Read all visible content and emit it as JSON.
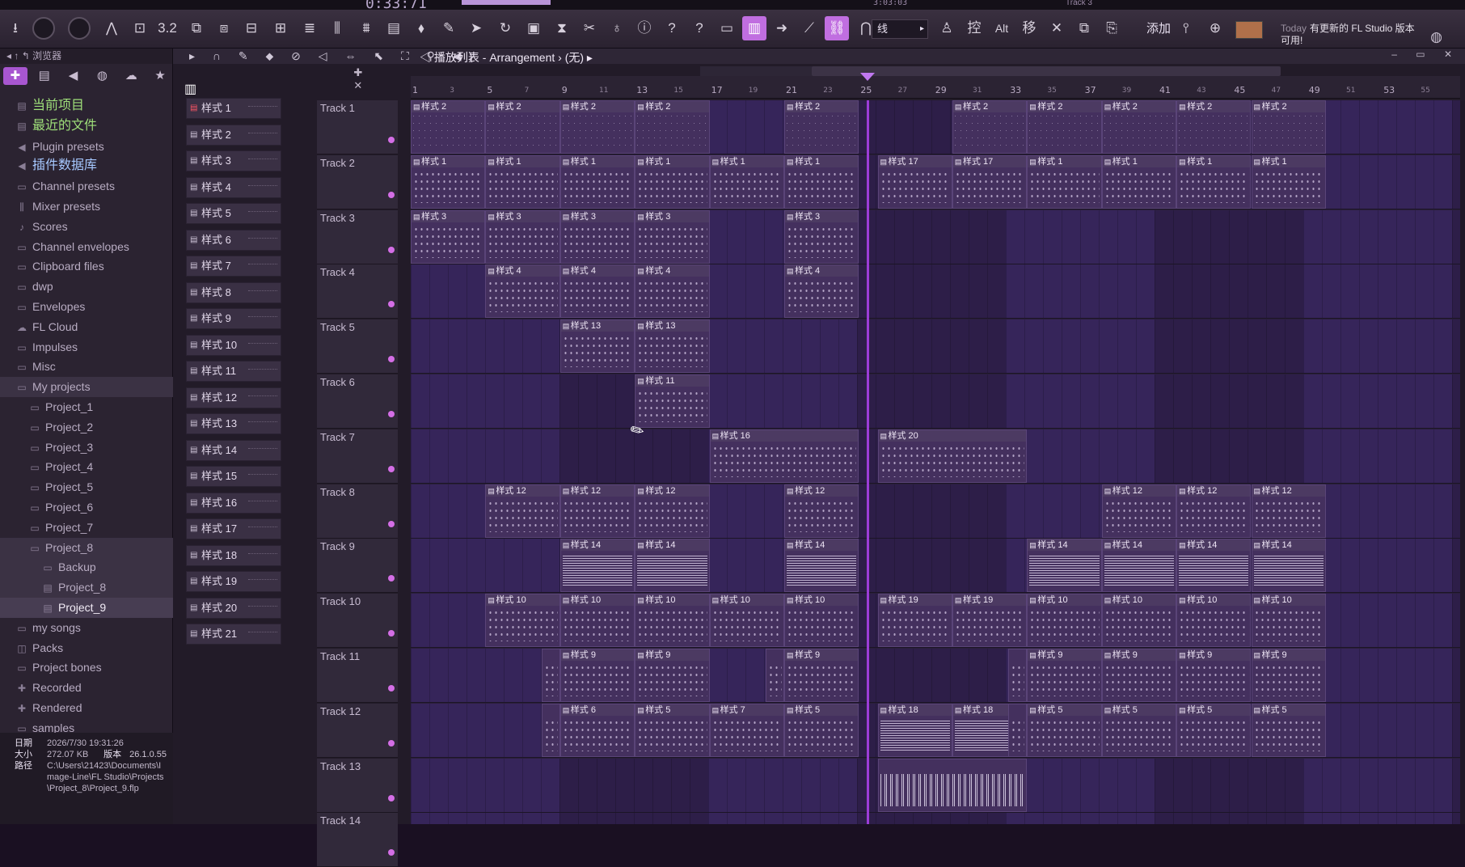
{
  "top_strip": {
    "time": "0:33:71",
    "small_readout": "3:03:03",
    "track_readout": "Track 3"
  },
  "toolbar": {
    "snap_value": "线",
    "add_label": "添加",
    "news_today": "Today",
    "news_text": "有更新的 FL Studio 版本可用!",
    "buttons": [
      {
        "name": "save-icon",
        "glyph": "⭳"
      },
      {
        "name": "master-knob",
        "glyph": ""
      },
      {
        "name": "pitch-knob",
        "glyph": ""
      },
      {
        "name": "tempo-tap-icon",
        "glyph": "⋀"
      },
      {
        "name": "metronome-icon",
        "glyph": "⊡"
      },
      {
        "name": "count-icon",
        "glyph": "3.2"
      },
      {
        "name": "step-icon",
        "glyph": "⧉"
      },
      {
        "name": "wait-icon",
        "glyph": "⧈"
      },
      {
        "name": "loop-rec-icon",
        "glyph": "⊟"
      },
      {
        "name": "overdub-icon",
        "glyph": "⊞"
      },
      {
        "name": "blend-icon",
        "glyph": "≣"
      },
      {
        "name": "mixer-icon",
        "glyph": "⫼"
      },
      {
        "name": "channel-rack-icon",
        "glyph": "⩩"
      },
      {
        "name": "file-icon",
        "glyph": "▤"
      },
      {
        "name": "plugin-icon",
        "glyph": "⬧"
      },
      {
        "name": "brush-icon",
        "glyph": "✎"
      },
      {
        "name": "dragon-icon",
        "glyph": "➤"
      },
      {
        "name": "undo-icon",
        "glyph": "↻"
      },
      {
        "name": "floppy-icon",
        "glyph": "▣"
      },
      {
        "name": "render-icon",
        "glyph": "⧗"
      },
      {
        "name": "scissors-icon",
        "glyph": "✂"
      },
      {
        "name": "mic-icon",
        "glyph": "♁"
      },
      {
        "name": "info-icon",
        "glyph": "ⓘ"
      },
      {
        "name": "help-bubble-icon",
        "glyph": "?"
      },
      {
        "name": "help-icon",
        "glyph": "?"
      },
      {
        "name": "window-icon",
        "glyph": "▭"
      },
      {
        "name": "piano-roll-icon",
        "glyph": "▥"
      },
      {
        "name": "arrow-right-icon",
        "glyph": "➜"
      },
      {
        "name": "draw-icon",
        "glyph": "⟋"
      },
      {
        "name": "link-icon",
        "glyph": "⛓"
      },
      {
        "name": "magnet-icon",
        "glyph": "⋂"
      }
    ],
    "right_buttons": [
      {
        "name": "stamp-icon",
        "glyph": "♙"
      },
      {
        "name": "control-icon",
        "glyph": "控"
      },
      {
        "name": "alt-icon",
        "glyph": "Alt"
      },
      {
        "name": "move-icon",
        "glyph": "移"
      },
      {
        "name": "cut-icon",
        "glyph": "✕"
      },
      {
        "name": "copy-icon",
        "glyph": "⧉"
      },
      {
        "name": "paste-icon",
        "glyph": "⎘"
      }
    ]
  },
  "browser": {
    "title": "浏览器",
    "tabs": [
      {
        "name": "all",
        "glyph": "✚"
      },
      {
        "name": "files",
        "glyph": "▤"
      },
      {
        "name": "speaker",
        "glyph": "◀"
      },
      {
        "name": "plugins",
        "glyph": "◍"
      },
      {
        "name": "cloud",
        "glyph": "☁"
      },
      {
        "name": "star",
        "glyph": "★"
      }
    ],
    "items": [
      {
        "label": "当前项目",
        "style": "hl",
        "icon": "▤"
      },
      {
        "label": "最近的文件",
        "style": "hl",
        "icon": "▤"
      },
      {
        "label": "Plugin presets",
        "style": "",
        "icon": "◀"
      },
      {
        "label": "插件数据库",
        "style": "cyan",
        "icon": "◀"
      },
      {
        "label": "Channel presets",
        "style": "",
        "icon": "▭"
      },
      {
        "label": "Mixer presets",
        "style": "",
        "icon": "⫼"
      },
      {
        "label": "Scores",
        "style": "",
        "icon": "♪"
      },
      {
        "label": "Channel envelopes",
        "style": "",
        "icon": "▭"
      },
      {
        "label": "Clipboard files",
        "style": "",
        "icon": "▭"
      },
      {
        "label": "dwp",
        "style": "",
        "icon": "▭"
      },
      {
        "label": "Envelopes",
        "style": "",
        "icon": "▭"
      },
      {
        "label": "FL Cloud",
        "style": "",
        "icon": "☁"
      },
      {
        "label": "Impulses",
        "style": "",
        "icon": "▭"
      },
      {
        "label": "Misc",
        "style": "",
        "icon": "▭"
      },
      {
        "label": "My projects",
        "style": "sel",
        "icon": "▭"
      },
      {
        "label": "Project_1",
        "style": "l1",
        "icon": "▭"
      },
      {
        "label": "Project_2",
        "style": "l1",
        "icon": "▭"
      },
      {
        "label": "Project_3",
        "style": "l1",
        "icon": "▭"
      },
      {
        "label": "Project_4",
        "style": "l1",
        "icon": "▭"
      },
      {
        "label": "Project_5",
        "style": "l1",
        "icon": "▭"
      },
      {
        "label": "Project_6",
        "style": "l1",
        "icon": "▭"
      },
      {
        "label": "Project_7",
        "style": "l1",
        "icon": "▭"
      },
      {
        "label": "Project_8",
        "style": "l1 sel",
        "icon": "▭"
      },
      {
        "label": "Backup",
        "style": "l2 sel",
        "icon": "▭"
      },
      {
        "label": "Project_8",
        "style": "l2 sel",
        "icon": "▤"
      },
      {
        "label": "Project_9",
        "style": "l3 sel2",
        "icon": "▤"
      },
      {
        "label": "my songs",
        "style": "",
        "icon": "▭"
      },
      {
        "label": "Packs",
        "style": "",
        "icon": "◫"
      },
      {
        "label": "Project bones",
        "style": "",
        "icon": "▭"
      },
      {
        "label": "Recorded",
        "style": "",
        "icon": "✚"
      },
      {
        "label": "Rendered",
        "style": "",
        "icon": "✚"
      },
      {
        "label": "samples",
        "style": "",
        "icon": "▭"
      }
    ],
    "info": {
      "date_label": "日期",
      "date_value": "2026/7/30 19:31:26",
      "size_label": "大小",
      "size_value": "272.07 KB",
      "version_label": "版本",
      "version_value": "26.1.0.55",
      "path_label": "路径",
      "path_value": "C:\\Users\\21423\\Documents\\Image-Line\\FL Studio\\Projects\\Project_8\\Project_9.flp"
    }
  },
  "playlist": {
    "title": "播放列表 - Arrangement",
    "title_sep": "›",
    "pattern_name": "(无)",
    "patterns": [
      "样式 1",
      "样式 2",
      "样式 3",
      "样式 4",
      "样式 5",
      "样式 6",
      "样式 7",
      "样式 8",
      "样式 9",
      "样式 10",
      "样式 11",
      "样式 12",
      "样式 13",
      "样式 14",
      "样式 15",
      "样式 16",
      "样式 17",
      "样式 18",
      "样式 19",
      "样式 20",
      "样式 21"
    ],
    "bar_numbers": [
      "1",
      "3",
      "5",
      "7",
      "9",
      "11",
      "13",
      "15",
      "17",
      "19",
      "21",
      "23",
      "25",
      "27",
      "29",
      "31",
      "33",
      "35",
      "37",
      "39",
      "41",
      "43",
      "45",
      "47",
      "49",
      "51",
      "53",
      "55"
    ],
    "tracks": [
      "Track 1",
      "Track 2",
      "Track 3",
      "Track 4",
      "Track 5",
      "Track 6",
      "Track 7",
      "Track 8",
      "Track 9",
      "Track 10",
      "Track 11",
      "Track 12",
      "Track 13",
      "Track 14"
    ],
    "clips": [
      {
        "track": 0,
        "bar": 1,
        "len": 4,
        "label": "样式 2",
        "fill": "diag"
      },
      {
        "track": 0,
        "bar": 5,
        "len": 4,
        "label": "样式 2",
        "fill": "diag"
      },
      {
        "track": 0,
        "bar": 9,
        "len": 4,
        "label": "样式 2",
        "fill": "diag"
      },
      {
        "track": 0,
        "bar": 13,
        "len": 4,
        "label": "样式 2",
        "fill": "diag"
      },
      {
        "track": 0,
        "bar": 21,
        "len": 4,
        "label": "样式 2",
        "fill": "diag"
      },
      {
        "track": 0,
        "bar": 30,
        "len": 4,
        "label": "样式 2",
        "fill": "diag"
      },
      {
        "track": 0,
        "bar": 34,
        "len": 4,
        "label": "样式 2",
        "fill": "diag"
      },
      {
        "track": 0,
        "bar": 38,
        "len": 4,
        "label": "样式 2",
        "fill": "diag"
      },
      {
        "track": 0,
        "bar": 42,
        "len": 4,
        "label": "样式 2",
        "fill": "diag"
      },
      {
        "track": 0,
        "bar": 46,
        "len": 4,
        "label": "样式 2",
        "fill": "diag"
      },
      {
        "track": 1,
        "bar": 1,
        "len": 4,
        "label": "样式 1",
        "fill": "dots"
      },
      {
        "track": 1,
        "bar": 5,
        "len": 4,
        "label": "样式 1",
        "fill": "dots"
      },
      {
        "track": 1,
        "bar": 9,
        "len": 4,
        "label": "样式 1",
        "fill": "dots"
      },
      {
        "track": 1,
        "bar": 13,
        "len": 4,
        "label": "样式 1",
        "fill": "dots"
      },
      {
        "track": 1,
        "bar": 17,
        "len": 4,
        "label": "样式 1",
        "fill": "dots"
      },
      {
        "track": 1,
        "bar": 21,
        "len": 4,
        "label": "样式 1",
        "fill": "dots"
      },
      {
        "track": 1,
        "bar": 26,
        "len": 4,
        "label": "样式 17",
        "fill": "dots"
      },
      {
        "track": 1,
        "bar": 30,
        "len": 4,
        "label": "样式 17",
        "fill": "dots"
      },
      {
        "track": 1,
        "bar": 34,
        "len": 4,
        "label": "样式 1",
        "fill": "dots"
      },
      {
        "track": 1,
        "bar": 38,
        "len": 4,
        "label": "样式 1",
        "fill": "dots"
      },
      {
        "track": 1,
        "bar": 42,
        "len": 4,
        "label": "样式 1",
        "fill": "dots"
      },
      {
        "track": 1,
        "bar": 46,
        "len": 4,
        "label": "样式 1",
        "fill": "dots"
      },
      {
        "track": 2,
        "bar": 1,
        "len": 4,
        "label": "样式 3",
        "fill": "dots"
      },
      {
        "track": 2,
        "bar": 5,
        "len": 4,
        "label": "样式 3",
        "fill": "dots"
      },
      {
        "track": 2,
        "bar": 9,
        "len": 4,
        "label": "样式 3",
        "fill": "dots"
      },
      {
        "track": 2,
        "bar": 13,
        "len": 4,
        "label": "样式 3",
        "fill": "dots"
      },
      {
        "track": 2,
        "bar": 21,
        "len": 4,
        "label": "样式 3",
        "fill": "dots"
      },
      {
        "track": 3,
        "bar": 5,
        "len": 4,
        "label": "样式 4",
        "fill": "dots"
      },
      {
        "track": 3,
        "bar": 9,
        "len": 4,
        "label": "样式 4",
        "fill": "dots"
      },
      {
        "track": 3,
        "bar": 13,
        "len": 4,
        "label": "样式 4",
        "fill": "dots"
      },
      {
        "track": 3,
        "bar": 21,
        "len": 4,
        "label": "样式 4",
        "fill": "dots"
      },
      {
        "track": 4,
        "bar": 9,
        "len": 4,
        "label": "样式 13",
        "fill": "dots"
      },
      {
        "track": 4,
        "bar": 13,
        "len": 4,
        "label": "样式 13",
        "fill": "dots"
      },
      {
        "track": 5,
        "bar": 13,
        "len": 4,
        "label": "样式 11",
        "fill": "dots"
      },
      {
        "track": 6,
        "bar": 17,
        "len": 8,
        "label": "样式 16",
        "fill": "dots"
      },
      {
        "track": 6,
        "bar": 26,
        "len": 8,
        "label": "样式 20",
        "fill": "dots"
      },
      {
        "track": 7,
        "bar": 5,
        "len": 4,
        "label": "样式 12",
        "fill": "dots"
      },
      {
        "track": 7,
        "bar": 9,
        "len": 4,
        "label": "样式 12",
        "fill": "dots"
      },
      {
        "track": 7,
        "bar": 13,
        "len": 4,
        "label": "样式 12",
        "fill": "dots"
      },
      {
        "track": 7,
        "bar": 21,
        "len": 4,
        "label": "样式 12",
        "fill": "dots"
      },
      {
        "track": 7,
        "bar": 38,
        "len": 4,
        "label": "样式 12",
        "fill": "dots"
      },
      {
        "track": 7,
        "bar": 42,
        "len": 4,
        "label": "样式 12",
        "fill": "dots"
      },
      {
        "track": 7,
        "bar": 46,
        "len": 4,
        "label": "样式 12",
        "fill": "dots"
      },
      {
        "track": 8,
        "bar": 9,
        "len": 4,
        "label": "样式 14",
        "fill": "dense"
      },
      {
        "track": 8,
        "bar": 13,
        "len": 4,
        "label": "样式 14",
        "fill": "dense"
      },
      {
        "track": 8,
        "bar": 21,
        "len": 4,
        "label": "样式 14",
        "fill": "dense"
      },
      {
        "track": 8,
        "bar": 34,
        "len": 4,
        "label": "样式 14",
        "fill": "dense"
      },
      {
        "track": 8,
        "bar": 38,
        "len": 4,
        "label": "样式 14",
        "fill": "dense"
      },
      {
        "track": 8,
        "bar": 42,
        "len": 4,
        "label": "样式 14",
        "fill": "dense"
      },
      {
        "track": 8,
        "bar": 46,
        "len": 4,
        "label": "样式 14",
        "fill": "dense"
      },
      {
        "track": 9,
        "bar": 5,
        "len": 4,
        "label": "样式 10",
        "fill": "dots"
      },
      {
        "track": 9,
        "bar": 9,
        "len": 4,
        "label": "样式 10",
        "fill": "dots"
      },
      {
        "track": 9,
        "bar": 13,
        "len": 4,
        "label": "样式 10",
        "fill": "dots"
      },
      {
        "track": 9,
        "bar": 17,
        "len": 4,
        "label": "样式 10",
        "fill": "dots"
      },
      {
        "track": 9,
        "bar": 21,
        "len": 4,
        "label": "样式 10",
        "fill": "dots"
      },
      {
        "track": 9,
        "bar": 26,
        "len": 4,
        "label": "样式 19",
        "fill": "dots"
      },
      {
        "track": 9,
        "bar": 30,
        "len": 4,
        "label": "样式 19",
        "fill": "dots"
      },
      {
        "track": 9,
        "bar": 34,
        "len": 4,
        "label": "样式 10",
        "fill": "dots"
      },
      {
        "track": 9,
        "bar": 38,
        "len": 4,
        "label": "样式 10",
        "fill": "dots"
      },
      {
        "track": 9,
        "bar": 42,
        "len": 4,
        "label": "样式 10",
        "fill": "dots"
      },
      {
        "track": 9,
        "bar": 46,
        "len": 4,
        "label": "样式 10",
        "fill": "dots"
      },
      {
        "track": 10,
        "bar": 8,
        "len": 1,
        "label": "",
        "fill": "dots"
      },
      {
        "track": 10,
        "bar": 9,
        "len": 4,
        "label": "样式 9",
        "fill": "dots"
      },
      {
        "track": 10,
        "bar": 13,
        "len": 4,
        "label": "样式 9",
        "fill": "dots"
      },
      {
        "track": 10,
        "bar": 20,
        "len": 1,
        "label": "",
        "fill": "dots"
      },
      {
        "track": 10,
        "bar": 21,
        "len": 4,
        "label": "样式 9",
        "fill": "dots"
      },
      {
        "track": 10,
        "bar": 33,
        "len": 1,
        "label": "",
        "fill": "dots"
      },
      {
        "track": 10,
        "bar": 34,
        "len": 4,
        "label": "样式 9",
        "fill": "dots"
      },
      {
        "track": 10,
        "bar": 38,
        "len": 4,
        "label": "样式 9",
        "fill": "dots"
      },
      {
        "track": 10,
        "bar": 42,
        "len": 4,
        "label": "样式 9",
        "fill": "dots"
      },
      {
        "track": 10,
        "bar": 46,
        "len": 4,
        "label": "样式 9",
        "fill": "dots"
      },
      {
        "track": 11,
        "bar": 8,
        "len": 1,
        "label": "",
        "fill": "dots"
      },
      {
        "track": 11,
        "bar": 9,
        "len": 4,
        "label": "样式 6",
        "fill": "dots"
      },
      {
        "track": 11,
        "bar": 13,
        "len": 4,
        "label": "样式 5",
        "fill": "dots"
      },
      {
        "track": 11,
        "bar": 17,
        "len": 4,
        "label": "样式 7",
        "fill": "dots"
      },
      {
        "track": 11,
        "bar": 21,
        "len": 4,
        "label": "样式 5",
        "fill": "dots"
      },
      {
        "track": 11,
        "bar": 26,
        "len": 4,
        "label": "样式 18",
        "fill": "dense"
      },
      {
        "track": 11,
        "bar": 30,
        "len": 4,
        "label": "样式 18",
        "fill": "dense"
      },
      {
        "track": 11,
        "bar": 33,
        "len": 1,
        "label": "",
        "fill": "dots"
      },
      {
        "track": 11,
        "bar": 34,
        "len": 4,
        "label": "样式 5",
        "fill": "dots"
      },
      {
        "track": 11,
        "bar": 38,
        "len": 4,
        "label": "样式 5",
        "fill": "dots"
      },
      {
        "track": 11,
        "bar": 42,
        "len": 4,
        "label": "样式 5",
        "fill": "dots"
      },
      {
        "track": 11,
        "bar": 46,
        "len": 4,
        "label": "样式 5",
        "fill": "dots"
      },
      {
        "track": 12,
        "bar": 26,
        "len": 8,
        "label": "",
        "fill": "vbars"
      }
    ],
    "playhead_bar": 25.4
  }
}
